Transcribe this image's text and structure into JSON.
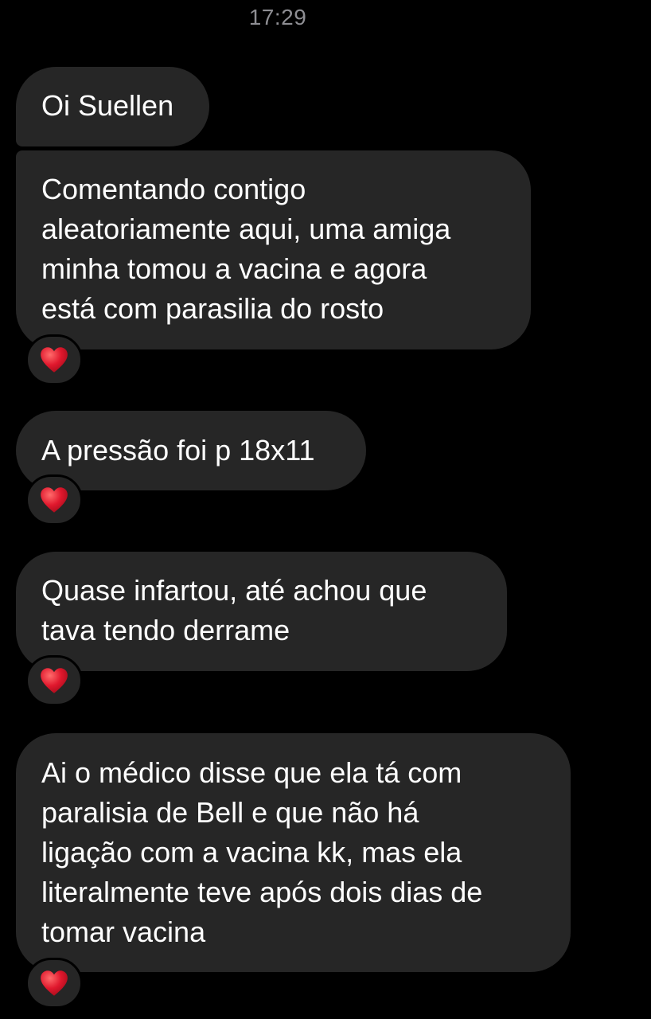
{
  "header": {
    "timestamp": "17:29"
  },
  "colors": {
    "background": "#000000",
    "bubble": "#262626",
    "text": "#ffffff",
    "timestamp": "#8e8e93",
    "heart": "#e0182d"
  },
  "messages": [
    {
      "lines": [
        "Oi Suellen"
      ],
      "reaction": null
    },
    {
      "lines": [
        "Comentando contigo",
        "aleatoriamente aqui, uma amiga",
        "minha tomou a vacina e agora",
        "está com parasilia do rosto"
      ],
      "reaction": "heart-icon"
    },
    {
      "lines": [
        "A pressão foi p 18x11"
      ],
      "reaction": "heart-icon"
    },
    {
      "lines": [
        "Quase infartou, até achou que",
        "tava tendo derrame"
      ],
      "reaction": "heart-icon"
    },
    {
      "lines": [
        "Ai o médico disse que ela tá com",
        "paralisia de Bell e que não há",
        "ligação com a vacina kk, mas ela",
        "literalmente teve após dois dias de",
        "tomar vacina"
      ],
      "reaction": "heart-icon"
    }
  ]
}
